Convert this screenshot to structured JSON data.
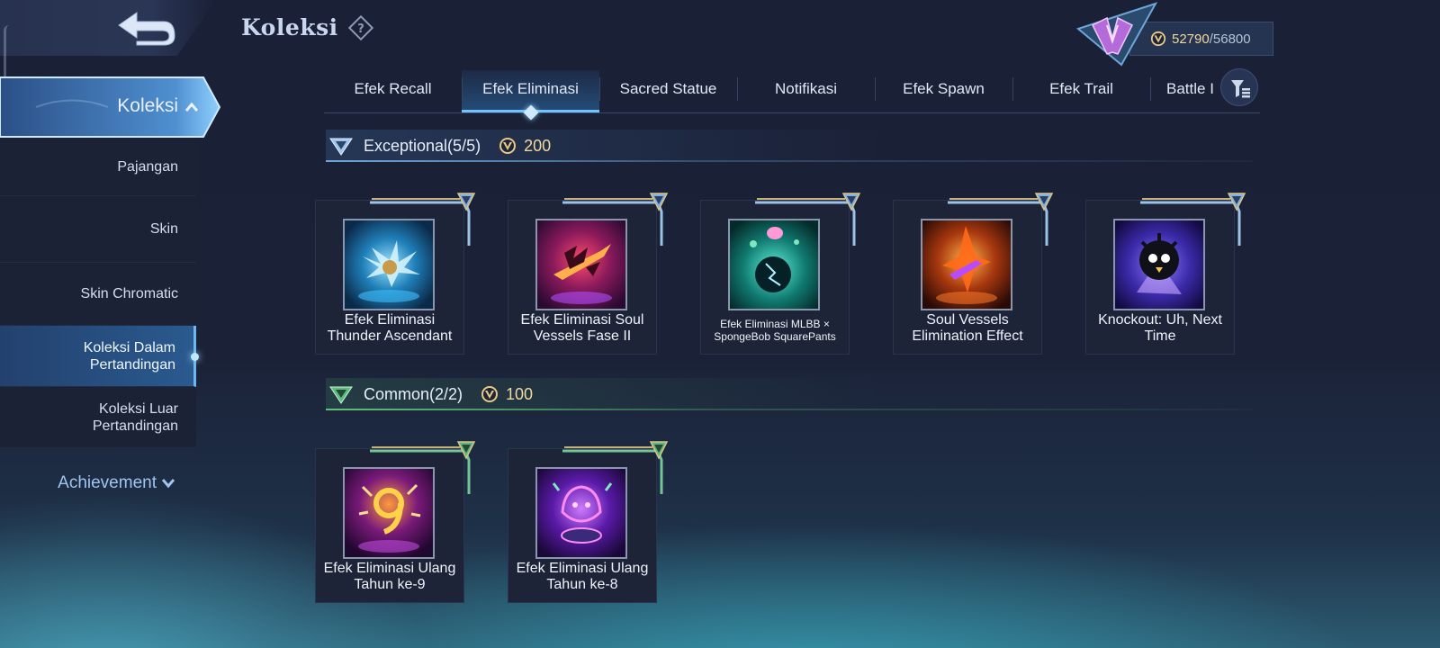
{
  "header": {
    "title": "Koleksi",
    "currency_value": "52790",
    "currency_separator": "/",
    "currency_max": "56800"
  },
  "sidebar": {
    "active_group": "Koleksi",
    "items": [
      {
        "label": "Pajangan"
      },
      {
        "label": "Skin"
      },
      {
        "label": "Skin Chromatic"
      },
      {
        "label": "Koleksi Dalam Pertandingan"
      },
      {
        "label": "Koleksi Luar Pertandingan"
      }
    ],
    "achievement": "Achievement"
  },
  "tabs": [
    {
      "label": "Efek Recall"
    },
    {
      "label": "Efek Eliminasi"
    },
    {
      "label": "Sacred Statue"
    },
    {
      "label": "Notifikasi"
    },
    {
      "label": "Efek Spawn"
    },
    {
      "label": "Efek Trail"
    },
    {
      "label": "Battle I"
    }
  ],
  "sections": {
    "exceptional": {
      "title": "Exceptional(5/5)",
      "cost": "200",
      "items": [
        {
          "name": "Efek Eliminasi Thunder Ascendant"
        },
        {
          "name": "Efek Eliminasi Soul Vessels Fase II"
        },
        {
          "name": "Efek Eliminasi MLBB × SpongeBob SquarePants"
        },
        {
          "name": "Soul Vessels Elimination Effect"
        },
        {
          "name": "Knockout: Uh, Next Time"
        }
      ]
    },
    "common": {
      "title": "Common(2/2)",
      "cost": "100",
      "items": [
        {
          "name": "Efek Eliminasi Ulang Tahun ke-9"
        },
        {
          "name": "Efek Eliminasi Ulang Tahun ke-8"
        }
      ]
    }
  },
  "colors": {
    "background": "#1b2238",
    "accent_blue": "#6fc4ff",
    "currency_gold": "#f0d9a0",
    "exceptional_line": "#6fa6d8",
    "common_line": "#5ec27a"
  }
}
